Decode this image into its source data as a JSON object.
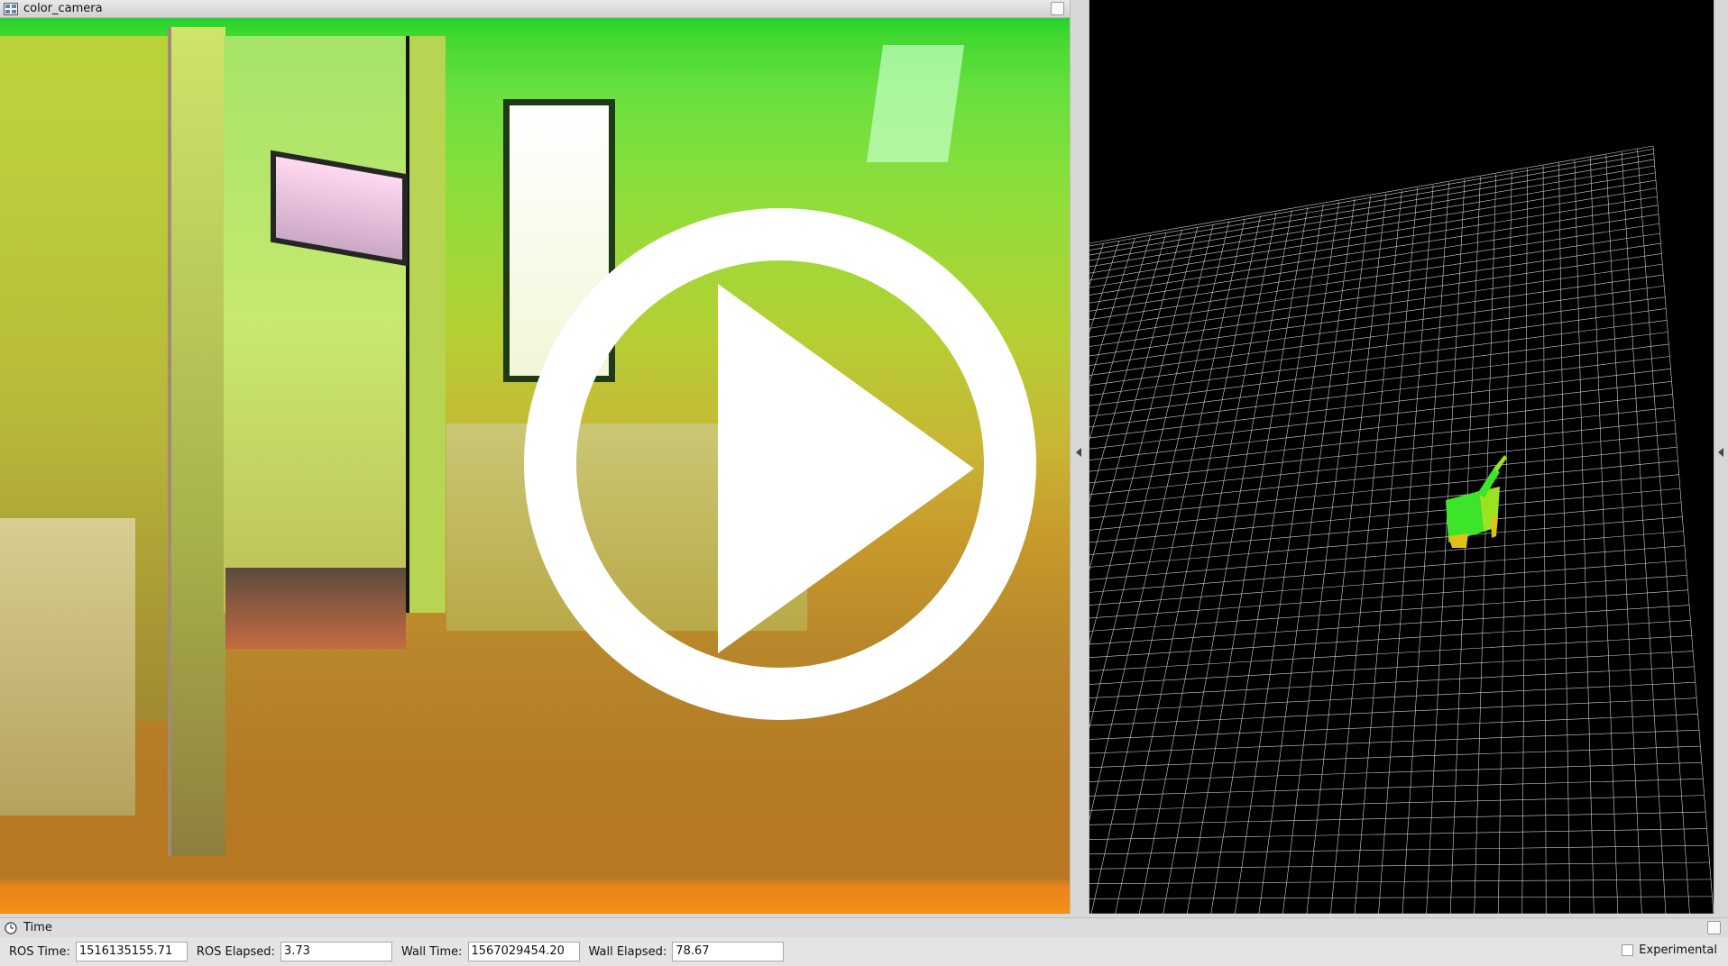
{
  "camera_panel": {
    "title": "color_camera",
    "title_icon": "image-view-icon",
    "float_icon": "float-window-icon"
  },
  "video_overlay": {
    "play_icon": "play-icon"
  },
  "viewport": {
    "background": "#000000",
    "grid_color": "#cfcfcf",
    "pointcloud_colors": [
      "#3de52a",
      "#9be320",
      "#e0c11a"
    ]
  },
  "time_panel": {
    "title": "Time",
    "title_icon": "clock-icon",
    "ros_time_label": "ROS Time:",
    "ros_time_value": "1516135155.71",
    "ros_elapsed_label": "ROS Elapsed:",
    "ros_elapsed_value": "3.73",
    "wall_time_label": "Wall Time:",
    "wall_time_value": "1567029454.20",
    "wall_elapsed_label": "Wall Elapsed:",
    "wall_elapsed_value": "78.67",
    "experimental_label": "Experimental",
    "experimental_checked": false
  }
}
